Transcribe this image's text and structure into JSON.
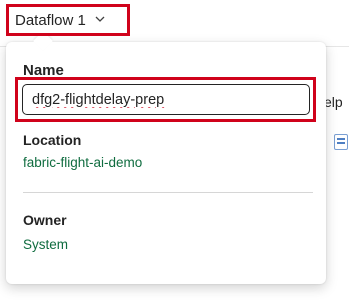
{
  "header": {
    "dataflow_title": "Dataflow 1",
    "chevron_icon": "chevron-down-icon"
  },
  "background": {
    "help_text": "elp",
    "toolbar_icon": "table-icon"
  },
  "popup": {
    "name_label": "Name",
    "name_value": "dfg2-flightdelay-prep",
    "location_label": "Location",
    "location_value": "fabric-flight-ai-demo",
    "owner_label": "Owner",
    "owner_value": "System"
  },
  "colors": {
    "highlight": "#d0021b",
    "link_green": "#0f6c3f"
  }
}
